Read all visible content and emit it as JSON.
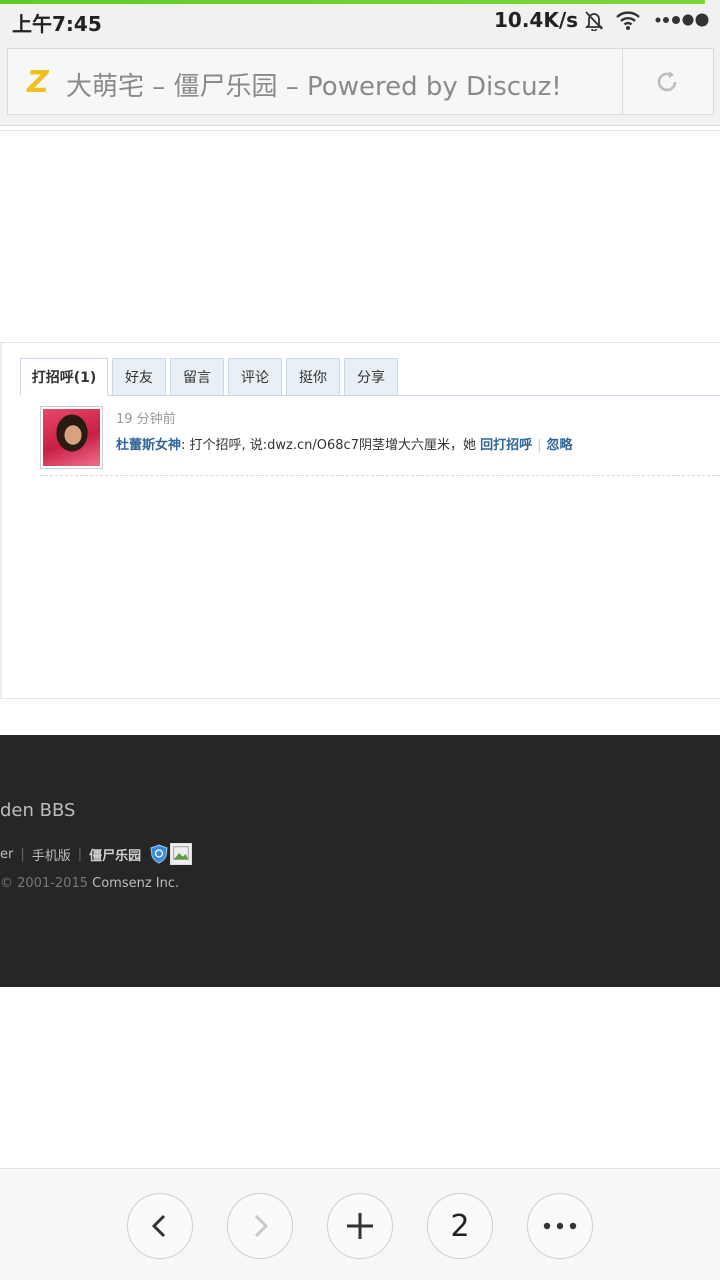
{
  "statusbar": {
    "time": "上午7:45",
    "speed": "10.4K/s"
  },
  "urlbar": {
    "logo_letter": "Z",
    "title": "大萌宅 – 僵尸乐园 – Powered by Discuz!"
  },
  "tabs": [
    {
      "label": "打招呼(1)",
      "active": true
    },
    {
      "label": "好友"
    },
    {
      "label": "留言"
    },
    {
      "label": "评论"
    },
    {
      "label": "挺你"
    },
    {
      "label": "分享"
    }
  ],
  "notice": {
    "time": "19 分钟前",
    "user": "杜蕾斯女神",
    "message": ": 打个招呼, 说:dwz.cn/O68c7阴茎增大六厘米，她",
    "reply": "回打招呼",
    "separator": "|",
    "ignore": "忽略"
  },
  "footer": {
    "bbs": "den BBS",
    "link1": "er",
    "link2": "手机版",
    "link3": "僵尸乐园",
    "separator": "|",
    "copyright_years": "© 2001-2015",
    "company": "Comsenz Inc."
  },
  "bottom_nav": {
    "tab_count": "2"
  }
}
